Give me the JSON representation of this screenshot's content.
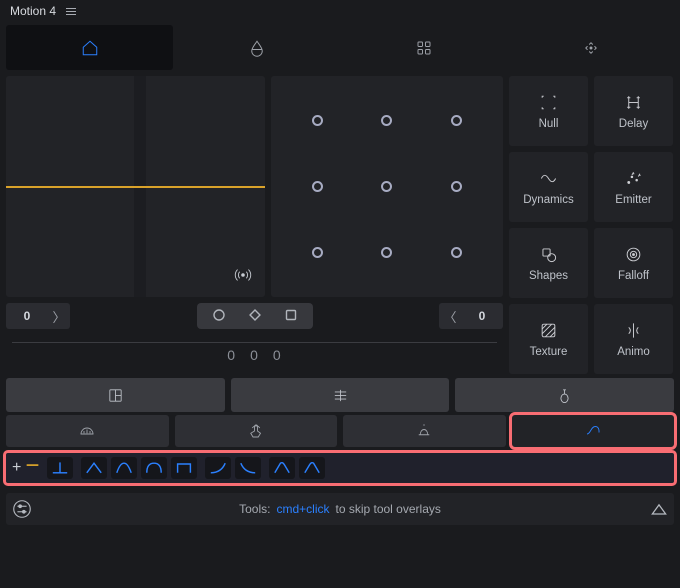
{
  "title": "Motion 4",
  "topTabs": [
    "home",
    "drop",
    "grid",
    "move"
  ],
  "activeTopTab": 0,
  "play": {
    "start": "0",
    "end": "0"
  },
  "scrub": {
    "ticks": [
      "0",
      "0",
      "0"
    ]
  },
  "tools": [
    {
      "key": "null",
      "label": "Null"
    },
    {
      "key": "delay",
      "label": "Delay"
    },
    {
      "key": "dynamics",
      "label": "Dynamics"
    },
    {
      "key": "emitter",
      "label": "Emitter"
    },
    {
      "key": "shapes",
      "label": "Shapes"
    },
    {
      "key": "falloff",
      "label": "Falloff"
    },
    {
      "key": "texture",
      "label": "Texture"
    },
    {
      "key": "animo",
      "label": "Animo"
    }
  ],
  "footer": {
    "prefix": "Tools:",
    "accent": "cmd+click",
    "suffix": "to skip tool overlays"
  },
  "curvePresets": [
    "linear",
    "easeIn",
    "easeInOut",
    "easeOut",
    "step",
    "expoIn",
    "expoOut",
    "bumpIn",
    "bumpOut"
  ],
  "selectedEditorTab": 3
}
